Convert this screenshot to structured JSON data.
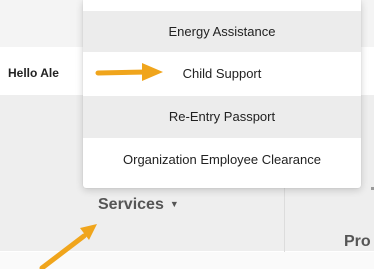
{
  "header": {
    "greeting": "Hello Ale"
  },
  "dropdown": {
    "items": [
      {
        "label": "Energy Assistance"
      },
      {
        "label": "Child Support"
      },
      {
        "label": "Re-Entry Passport"
      },
      {
        "label": "Organization Employee Clearance"
      }
    ]
  },
  "nav": {
    "services_label": "Services",
    "services_caret": "▼",
    "next_label_partial": "Pro"
  },
  "annotations": {
    "arrow_color": "#f0a51c"
  }
}
